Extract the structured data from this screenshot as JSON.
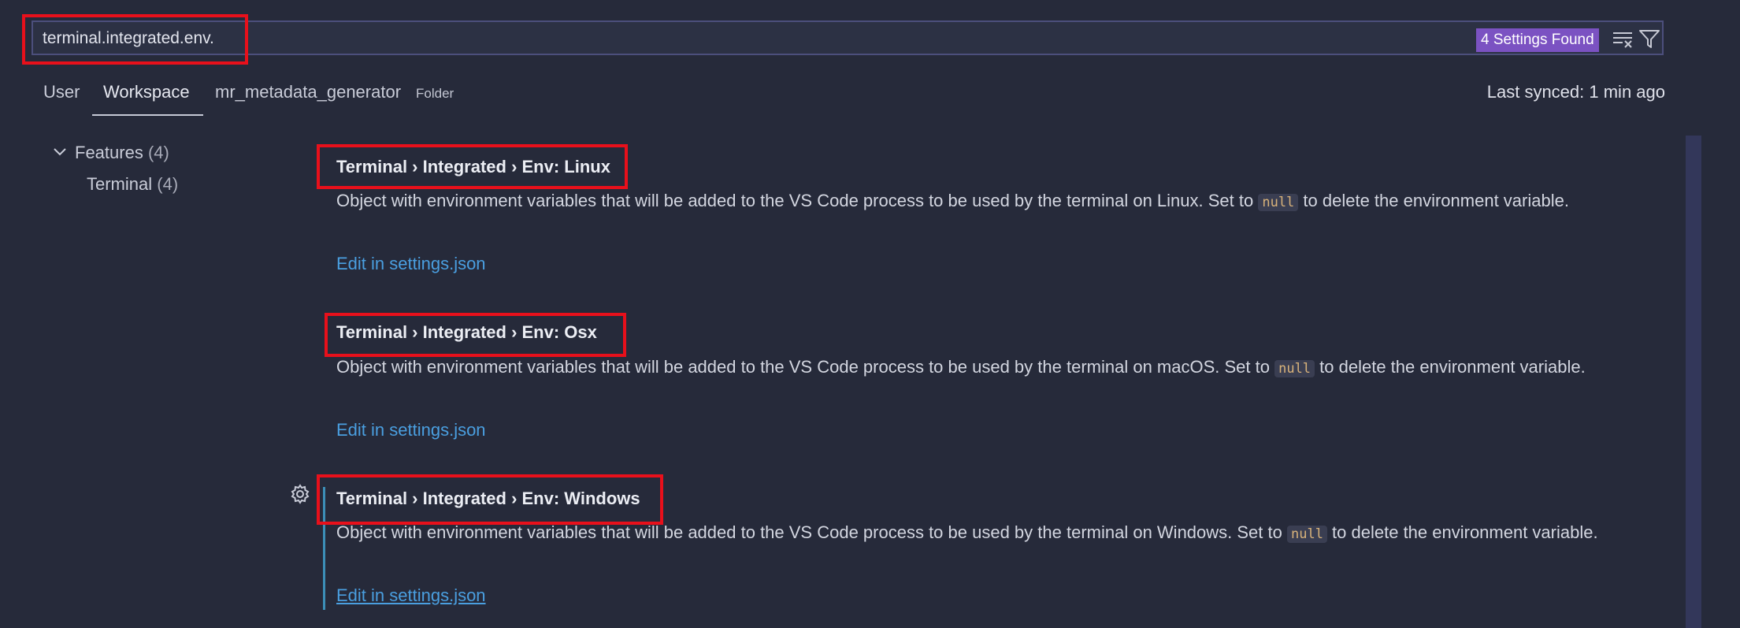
{
  "search": {
    "value": "terminal.integrated.env.",
    "results_badge": "4 Settings Found"
  },
  "toolbar": {
    "clear_icon": "clear-filter-icon",
    "filter_icon": "filter-icon"
  },
  "scope_tabs": {
    "user": "User",
    "workspace": "Workspace",
    "folder_name": "mr_metadata_generator",
    "folder_tag": "Folder"
  },
  "sync_status": "Last synced: 1 min ago",
  "tree": {
    "features_label": "Features",
    "features_count": "(4)",
    "terminal_label": "Terminal",
    "terminal_count": "(4)"
  },
  "settings": [
    {
      "title": "Terminal › Integrated › Env: Linux",
      "desc_before": "Object with environment variables that will be added to the VS Code process to be used by the terminal on Linux. Set to ",
      "code": "null",
      "desc_after": " to delete the environment variable.",
      "link": "Edit in settings.json"
    },
    {
      "title": "Terminal › Integrated › Env: Osx",
      "desc_before": "Object with environment variables that will be added to the VS Code process to be used by the terminal on macOS. Set to ",
      "code": "null",
      "desc_after": " to delete the environment variable.",
      "link": "Edit in settings.json"
    },
    {
      "title": "Terminal › Integrated › Env: Windows",
      "desc_before": "Object with environment variables that will be added to the VS Code process to be used by the terminal on Windows. Set to ",
      "code": "null",
      "desc_after": " to delete the environment variable.",
      "link": "Edit in settings.json"
    }
  ],
  "colors": {
    "background": "#262a3a",
    "accent_badge": "#7b52c2",
    "highlight_box": "#e8101b",
    "link": "#4a9fe0"
  }
}
